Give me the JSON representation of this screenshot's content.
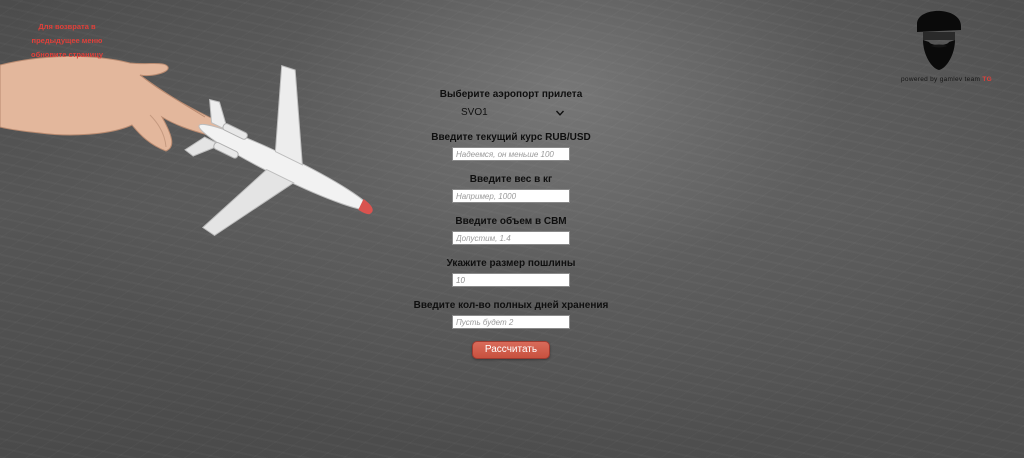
{
  "back_link": {
    "text": "Для возврата в предыдущее меню обновите страницу"
  },
  "logo": {
    "powered_prefix": "powered by gamlev team",
    "powered_accent": "TG"
  },
  "form": {
    "airport": {
      "label": "Выберите аэропорт прилета",
      "selected": "SVO1"
    },
    "rate": {
      "label": "Введите текущий курс RUB/USD",
      "placeholder": "Надеемся, он меньше 100"
    },
    "weight": {
      "label": "Введите вес в кг",
      "placeholder": "Например, 1000"
    },
    "volume": {
      "label": "Введите объем в CBM",
      "placeholder": "Допустим, 1.4"
    },
    "duty": {
      "label": "Укажите размер пошлины",
      "value": "10"
    },
    "storage": {
      "label": "Введите кол-во полных дней хранения",
      "placeholder": "Пусть будет 2"
    },
    "submit_label": "Рассчитать"
  },
  "colors": {
    "accent": "#e0403a",
    "button": "#d05e4c",
    "board": "#505050"
  },
  "icons": {
    "illustration": "hand-holding-airplane",
    "logo": "bearded-man-with-cap",
    "select_arrow": "chevron-down-icon"
  }
}
